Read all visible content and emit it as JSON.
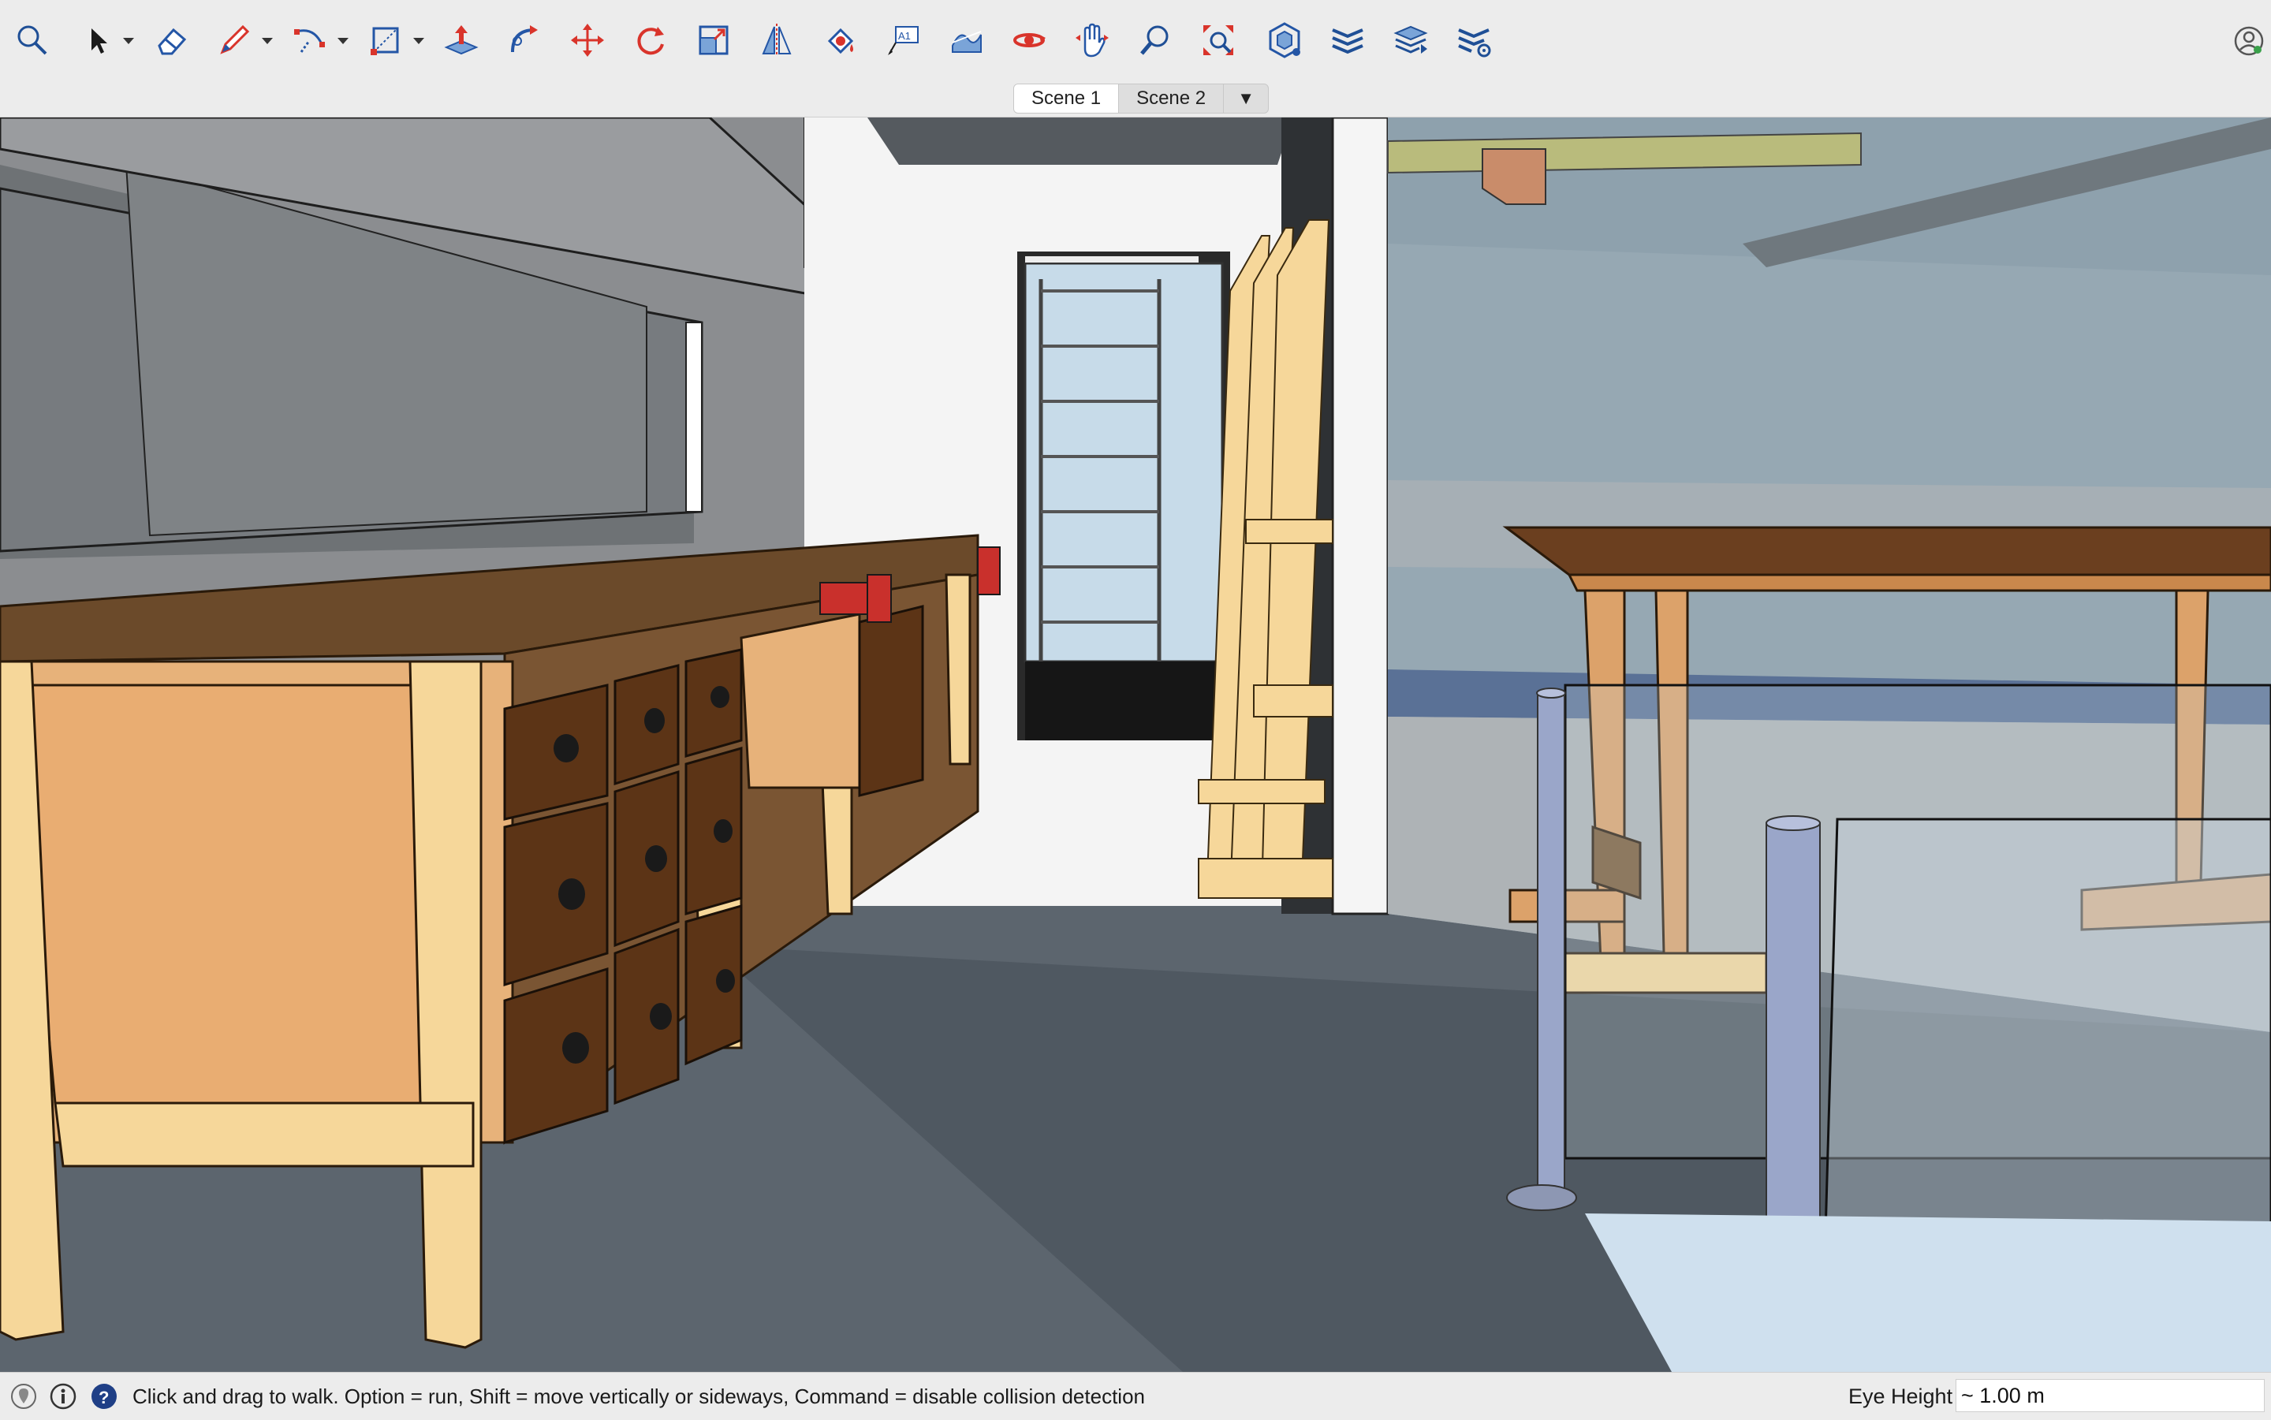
{
  "toolbar": {
    "tools": [
      {
        "id": "search",
        "icon": "search-icon"
      },
      {
        "id": "select",
        "icon": "select-arrow-icon"
      },
      {
        "id": "eraser",
        "icon": "eraser-icon"
      },
      {
        "id": "line",
        "icon": "pencil-icon"
      },
      {
        "id": "arc",
        "icon": "arc-icon"
      },
      {
        "id": "rectangle",
        "icon": "rectangle-icon"
      },
      {
        "id": "push-pull",
        "icon": "push-pull-icon"
      },
      {
        "id": "follow-me",
        "icon": "follow-me-icon"
      },
      {
        "id": "move",
        "icon": "move-icon"
      },
      {
        "id": "rotate",
        "icon": "rotate-icon"
      },
      {
        "id": "scale",
        "icon": "scale-icon"
      },
      {
        "id": "flip",
        "icon": "flip-icon"
      },
      {
        "id": "paint-bucket",
        "icon": "paint-bucket-icon"
      },
      {
        "id": "text",
        "icon": "text-icon"
      },
      {
        "id": "sandbox",
        "icon": "sandbox-icon"
      },
      {
        "id": "orbit",
        "icon": "orbit-icon"
      },
      {
        "id": "pan",
        "icon": "pan-hand-icon"
      },
      {
        "id": "zoom",
        "icon": "zoom-icon"
      },
      {
        "id": "zoom-extents",
        "icon": "zoom-extents-icon"
      },
      {
        "id": "components",
        "icon": "components-icon"
      },
      {
        "id": "tags",
        "icon": "tags-icon"
      },
      {
        "id": "scenes",
        "icon": "scenes-icon"
      },
      {
        "id": "styles",
        "icon": "styles-icon"
      }
    ],
    "account_icon": "account-icon"
  },
  "scenes": {
    "tabs": [
      {
        "label": "Scene 1",
        "active": true
      },
      {
        "label": "Scene 2",
        "active": false
      }
    ],
    "menu_glyph": "▼"
  },
  "viewport": {
    "description_icon": "3d-model-view"
  },
  "status": {
    "icons": [
      "geo-location-icon",
      "credits-icon",
      "help-icon"
    ],
    "message": "Click and drag to walk.  Option = run, Shift = move vertically or sideways, Command = disable collision detection",
    "vcb_label": "Eye Height",
    "vcb_value": "~ 1.00 m"
  },
  "colors": {
    "accent_red": "#d9342b",
    "accent_blue": "#2456a6",
    "wood_light": "#f6d79a",
    "wood_dark": "#6b3f1f"
  }
}
